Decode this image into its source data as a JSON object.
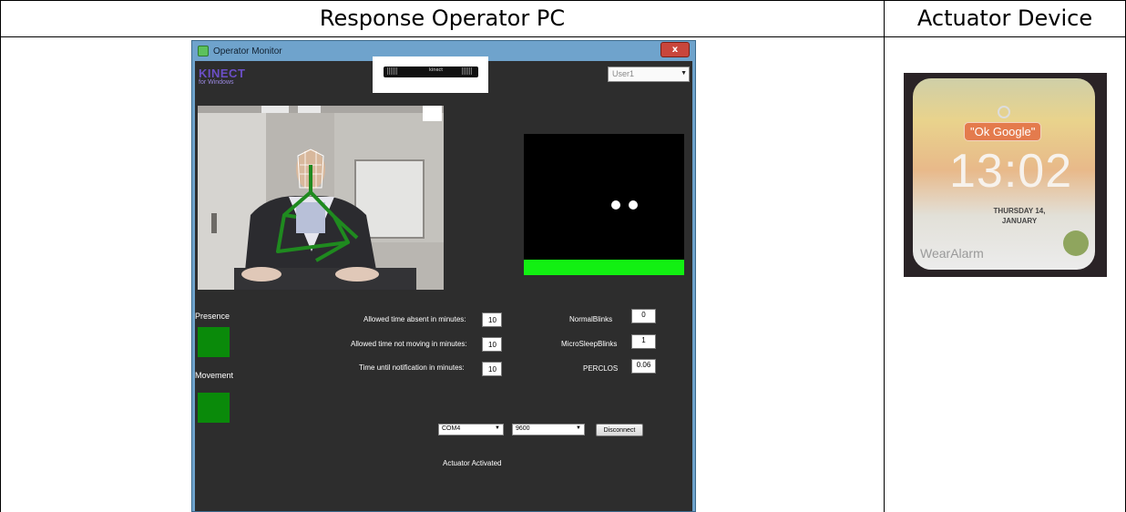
{
  "table": {
    "col1_header": "Response Operator PC",
    "col2_header": "Actuator Device"
  },
  "window": {
    "title": "Operator Monitor",
    "close_label": "x",
    "logo_main": "KINECT",
    "logo_sub": "for Windows",
    "sensor_label": "kinect",
    "user_select": "User1",
    "presence_label": "Presence",
    "movement_label": "Movement",
    "presence_color": "#0a8a0a",
    "movement_color": "#0a8a0a",
    "fields": {
      "absent_label": "Allowed time absent in minutes:",
      "absent_value": "10",
      "not_moving_label": "Allowed time not moving in minutes:",
      "not_moving_value": "10",
      "notify_label": "Time until notification in minutes:",
      "notify_value": "10"
    },
    "stats": {
      "normal_blinks_label": "NormalBlinks",
      "normal_blinks_value": "0",
      "micro_sleep_label": "MicroSleepBlinks",
      "micro_sleep_value": "1",
      "perclos_label": "PERCLOS",
      "perclos_value": "0.06"
    },
    "port": "COM4",
    "baud": "9600",
    "disconnect_label": "Disconnect",
    "actuator_status": "Actuator Activated",
    "perclos_bar_color": "#12f012"
  },
  "watch": {
    "prompt": "\"Ok Google\"",
    "time": "13:02",
    "date_line1": "THURSDAY 14,",
    "date_line2": "JANUARY",
    "app_name": "WearAlarm"
  }
}
